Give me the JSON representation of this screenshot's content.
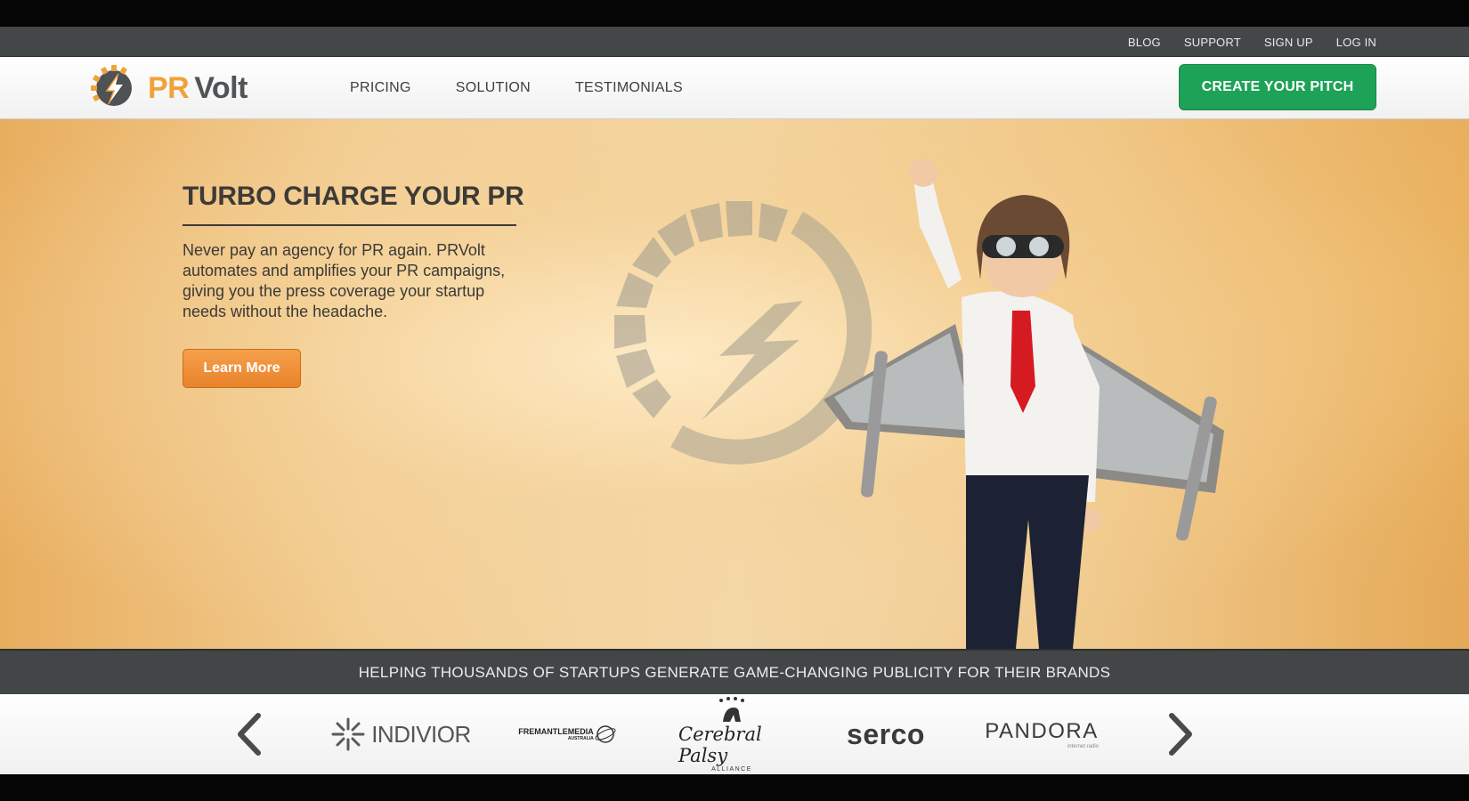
{
  "utility_nav": {
    "items": [
      "BLOG",
      "SUPPORT",
      "SIGN UP",
      "LOG IN"
    ]
  },
  "brand": {
    "name_part1": "PR",
    "name_part2": "Volt",
    "accent_color": "#f0a23a",
    "dark_color": "#505456"
  },
  "main_nav": {
    "items": [
      "PRICING",
      "SOLUTION",
      "TESTIMONIALS"
    ],
    "cta_label": "CREATE YOUR PITCH",
    "cta_color": "#1ea257"
  },
  "hero": {
    "title": "TURBO CHARGE YOUR PR",
    "text": "Never pay an agency for PR again. PRVolt automates and amplifies your PR campaigns, giving you the press coverage your startup needs without the headache.",
    "button_label": "Learn More",
    "button_color": "#f0922f",
    "image": "boy-with-cardboard-wings-image",
    "emblem": "lightning-bolt-emblem"
  },
  "tagline": {
    "text": "HELPING THOUSANDS OF STARTUPS GENERATE GAME-CHANGING PUBLICITY FOR THEIR BRANDS"
  },
  "clients": {
    "prev_icon": "chevron-left-icon",
    "next_icon": "chevron-right-icon",
    "indivior": "INDIVIOR",
    "fremantle": "FREMANTLEMEDIA",
    "fremantle_sub": "AUSTRALIA",
    "cerebral_palsy": "Cerebral Palsy",
    "cerebral_palsy_sub": "ALLIANCE",
    "serco": "serco",
    "pandora": "PANDORA",
    "pandora_sub": "internet radio"
  }
}
